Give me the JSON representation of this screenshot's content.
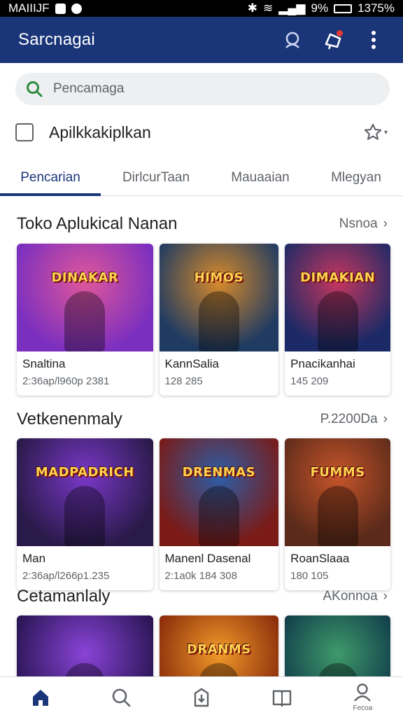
{
  "status_bar": {
    "left_text": "MAIIIJF",
    "right_text": "9%",
    "time": "1375%"
  },
  "app_bar": {
    "title": "Sarcnagai",
    "icons": [
      "account-icon",
      "notification-icon",
      "more-vert-icon"
    ]
  },
  "search": {
    "placeholder": "Pencamaga"
  },
  "filter": {
    "label": "Apilkkakiplkan"
  },
  "tabs": [
    {
      "label": "Pencarian",
      "active": true
    },
    {
      "label": "DirlcurTaan",
      "active": false
    },
    {
      "label": "Mauaaian",
      "active": false
    },
    {
      "label": "Mlegyan",
      "active": false
    }
  ],
  "sections": [
    {
      "title": "Toko Aplukical Nanan",
      "more_label": "Nsnoa",
      "cards": [
        {
          "logo": "DINAKAR",
          "title": "Snaltina",
          "meta": "2:36ap/l960p 2381",
          "colors": [
            "#7b2fbf",
            "#e0579a"
          ]
        },
        {
          "logo": "HIMOS",
          "title": "KannSalia",
          "meta": "128 285",
          "colors": [
            "#1f3b62",
            "#d88a2a"
          ]
        },
        {
          "logo": "DIMAKIAN",
          "title": "Pnacikanhai",
          "meta": "145 209",
          "colors": [
            "#1b2a66",
            "#c6365e"
          ]
        }
      ]
    },
    {
      "title": "Vetkenenmaly",
      "more_label": "P.2200Da",
      "cards": [
        {
          "logo": "MADPADRICH",
          "title": "Man",
          "meta": "2:36ap/l266p1.235",
          "colors": [
            "#2a1a4a",
            "#7a38c8"
          ]
        },
        {
          "logo": "DRENMAS",
          "title": "Manenl Dasenal",
          "meta": "2:1a0k 184 308",
          "colors": [
            "#7a1b17",
            "#2b5ea8"
          ]
        },
        {
          "logo": "FUMMS",
          "title": "RoanSlaaa",
          "meta": "180 105",
          "colors": [
            "#5b2a1a",
            "#c6552a"
          ]
        }
      ]
    },
    {
      "title": "Cetamanlaly",
      "more_label": "AKonnoa",
      "cards": [
        {
          "logo": "",
          "title": "",
          "meta": "",
          "colors": [
            "#2b1656",
            "#8a44d8"
          ]
        },
        {
          "logo": "DRANMS",
          "title": "",
          "meta": "",
          "colors": [
            "#8a2a0a",
            "#f09a2a"
          ]
        },
        {
          "logo": "",
          "title": "",
          "meta": "",
          "colors": [
            "#0f3a4a",
            "#3f9a6a"
          ]
        }
      ]
    }
  ],
  "bottom_nav": [
    {
      "icon": "home-icon",
      "label": "",
      "active": true
    },
    {
      "icon": "search-icon",
      "label": "",
      "active": false
    },
    {
      "icon": "install-icon",
      "label": "",
      "active": false
    },
    {
      "icon": "library-icon",
      "label": "",
      "active": false
    },
    {
      "icon": "profile-icon",
      "label": "Fecoa",
      "active": false
    }
  ],
  "colors": {
    "primary": "#1a3578",
    "search_icon": "#2e8b3e",
    "notif_dot": "#e53935"
  }
}
